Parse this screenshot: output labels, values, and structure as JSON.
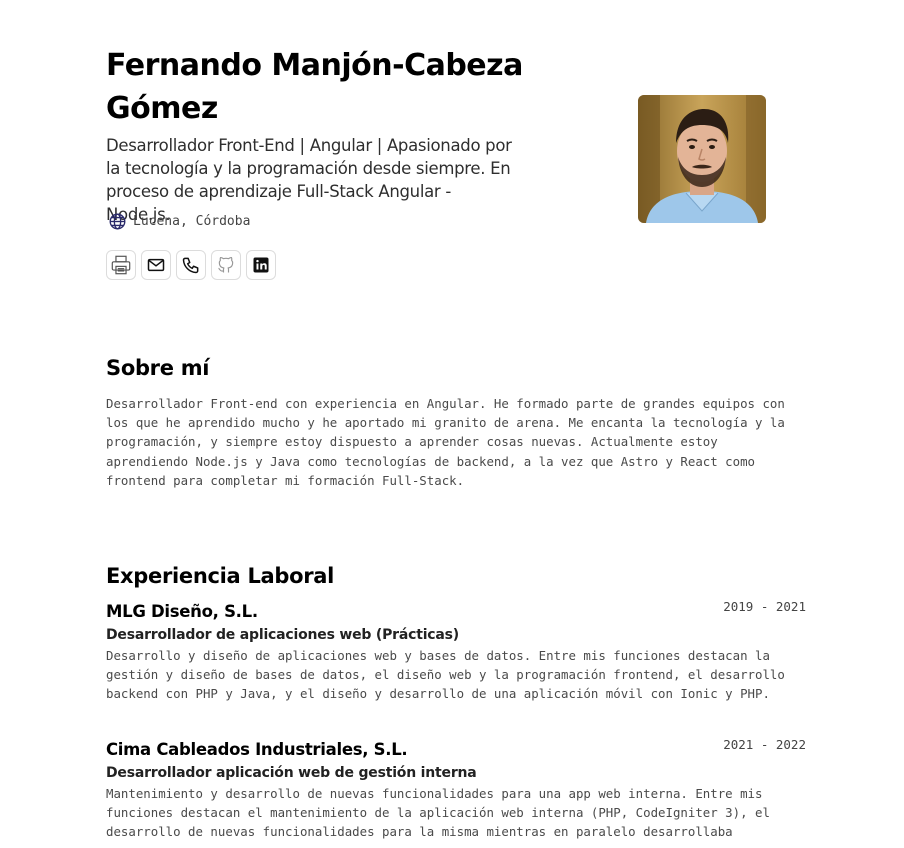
{
  "profile": {
    "name": "Fernando Manjón-Cabeza Gómez",
    "tagline": "Desarrollador Front-End | Angular | Apasionado por la tecnología y la programación desde siempre. En proceso de aprendizaje Full-Stack Angular - Node.js.",
    "location": "Lucena, Córdoba",
    "location_icon": "globe-icon",
    "contacts": [
      {
        "icon": "printer-icon"
      },
      {
        "icon": "mail-icon"
      },
      {
        "icon": "phone-icon"
      },
      {
        "icon": "github-icon"
      },
      {
        "icon": "linkedin-icon"
      }
    ]
  },
  "about": {
    "title": "Sobre mí",
    "text": "Desarrollador Front-end con experiencia en Angular. He formado parte de grandes equipos con los que he aprendido mucho y he aportado mi granito de arena. Me encanta la tecnología y la programación, y siempre estoy dispuesto a aprender cosas nuevas. Actualmente estoy aprendiendo Node.js y Java como tecnologías de backend, a la vez que Astro y React como frontend para completar mi formación Full-Stack."
  },
  "experience": {
    "title": "Experiencia Laboral",
    "jobs": [
      {
        "company": "MLG Diseño, S.L.",
        "dates": "2019 - 2021",
        "role": "Desarrollador de aplicaciones web (Prácticas)",
        "description": "Desarrollo y diseño de aplicaciones web y bases de datos. Entre mis funciones destacan la gestión y diseño de bases de datos, el diseño web y la programación frontend, el desarrollo backend con PHP y Java, y el diseño y desarrollo de una aplicación móvil con Ionic y PHP."
      },
      {
        "company": "Cima Cableados Industriales, S.L.",
        "dates": "2021 - 2022",
        "role": "Desarrollador aplicación web de gestión interna",
        "description": "Mantenimiento y desarrollo de nuevas funcionalidades para una app web interna. Entre mis funciones destacan el mantenimiento de la aplicación web interna (PHP, CodeIgniter 3), el desarrollo de nuevas funcionalidades para la misma mientras en paralelo desarrollaba"
      }
    ]
  }
}
